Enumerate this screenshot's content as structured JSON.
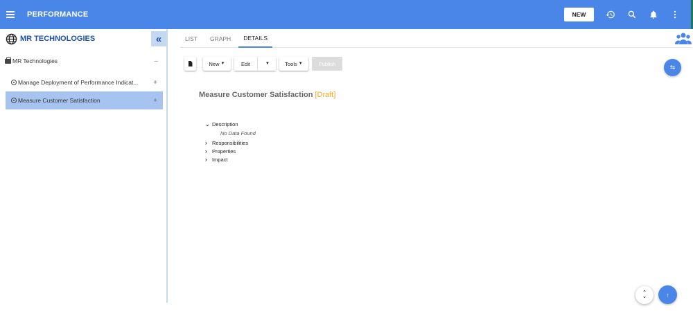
{
  "app": {
    "title": "PERFORMANCE"
  },
  "topbar": {
    "new_label": "NEW",
    "icons": [
      "history-icon",
      "search-icon",
      "bell-icon",
      "more-vert-icon"
    ]
  },
  "sidebar": {
    "title": "MR TECHNOLOGIES",
    "collapse_icon": "double-chevron-left-icon",
    "root": {
      "label": "MR Technologies",
      "toggle": "–"
    },
    "items": [
      {
        "label": "Manage Deployment of Performance Indicat...",
        "toggle": "+",
        "selected": false
      },
      {
        "label": "Measure Customer Satisfaction",
        "toggle": "+",
        "selected": true
      }
    ]
  },
  "tabs": [
    {
      "label": "LIST",
      "active": false
    },
    {
      "label": "GRAPH",
      "active": false
    },
    {
      "label": "DETAILS",
      "active": true
    }
  ],
  "toolbar": {
    "new_label": "New",
    "edit_label": "Edit",
    "tools_label": "Tools",
    "publish_label": "Publish"
  },
  "details": {
    "title": "Measure Customer Satisfaction",
    "status": "[Draft]",
    "sections": [
      {
        "label": "Description",
        "expanded": true,
        "empty_text": "No Data Found"
      },
      {
        "label": "Responsibilities",
        "expanded": false
      },
      {
        "label": "Properties",
        "expanded": false
      },
      {
        "label": "Impact",
        "expanded": false
      }
    ]
  },
  "colors": {
    "primary": "#4a86e8",
    "draft": "#f5a623",
    "selected": "#a6c4ef",
    "sidebar_title": "#1e4fae"
  }
}
